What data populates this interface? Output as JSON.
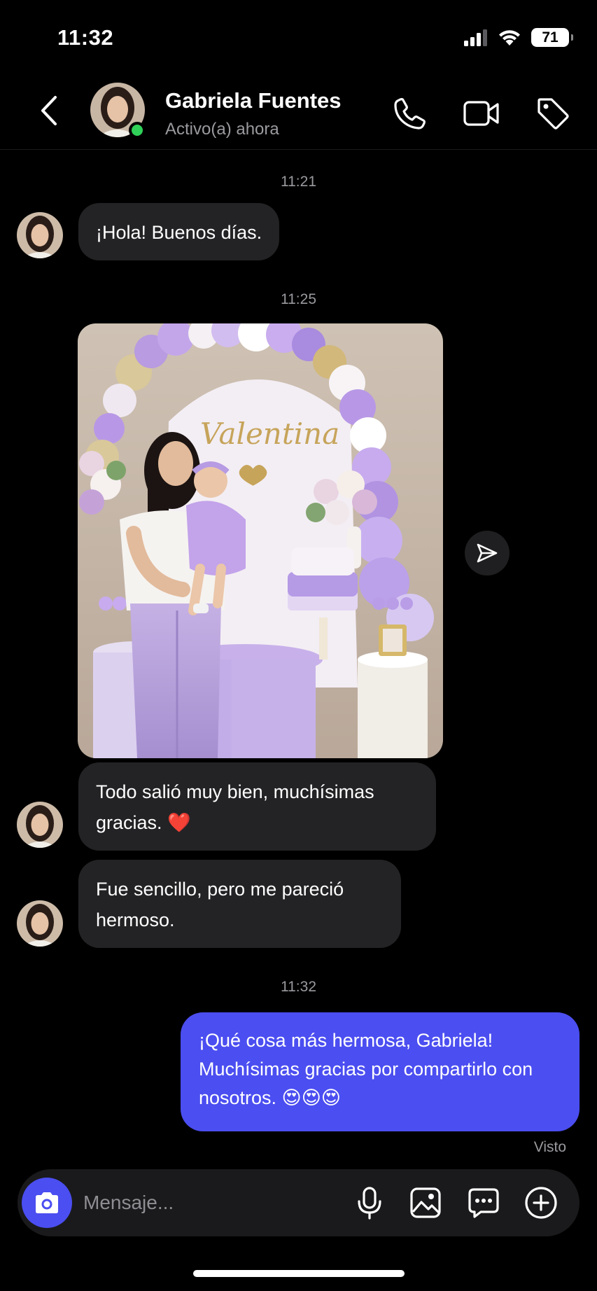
{
  "status_bar": {
    "time": "11:32",
    "battery": "71",
    "icons": [
      "signal-icon",
      "wifi-icon",
      "battery-icon"
    ]
  },
  "header": {
    "contact_name": "Gabriela Fuentes",
    "contact_status": "Activo(a) ahora",
    "icons": [
      "back-icon",
      "phone-icon",
      "video-icon",
      "tag-icon"
    ],
    "online_color": "#30d158"
  },
  "messages": {
    "time_1": "11:21",
    "msg_1": "¡Hola! Buenos días.",
    "time_2": "11:25",
    "photo_sign": "Valentina",
    "msg_2_line1": "Todo salió muy bien, muchísimas",
    "msg_2_line2": "gracias. ❤️",
    "msg_3_line1": "Fue sencillo, pero me pareció",
    "msg_3_line2": "hermoso.",
    "time_3": "11:32",
    "msg_4_line1": "¡Qué cosa más hermosa, Gabriela!",
    "msg_4_line2": "Muchísimas gracias por compartirlo con",
    "msg_4_line3": "nosotros. 😍😍😍",
    "seen_label": "Visto"
  },
  "composer": {
    "placeholder": "Mensaje...",
    "icons": [
      "camera-icon",
      "microphone-icon",
      "gallery-icon",
      "sticker-icon",
      "plus-icon"
    ]
  },
  "colors": {
    "accent": "#4b4ef0",
    "incoming_bubble": "#232325",
    "background": "#000000"
  }
}
